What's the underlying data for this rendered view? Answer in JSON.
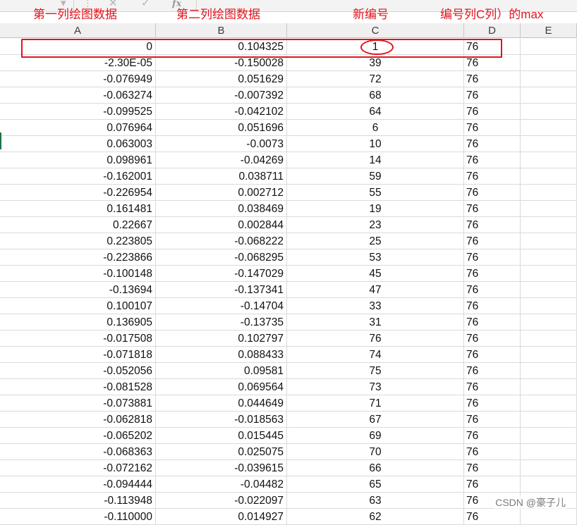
{
  "toolbar": {
    "dropdown_glyph": "▾",
    "more_glyph": "⋮",
    "cancel_glyph": "✕",
    "confirm_glyph": "✓",
    "fx_label": "fx"
  },
  "column_headers": [
    "A",
    "B",
    "C",
    "D",
    "E"
  ],
  "annotations": {
    "col_a": "第一列绘图数据",
    "col_b": "第二列绘图数据",
    "col_c": "新编号",
    "col_d": "编号列C列）的max"
  },
  "rows": [
    {
      "a": "0",
      "b": "0.104325",
      "c": "1",
      "d": "76"
    },
    {
      "a": "-2.30E-05",
      "b": "-0.150028",
      "c": "39",
      "d": "76"
    },
    {
      "a": "-0.076949",
      "b": "0.051629",
      "c": "72",
      "d": "76"
    },
    {
      "a": "-0.063274",
      "b": "-0.007392",
      "c": "68",
      "d": "76"
    },
    {
      "a": "-0.099525",
      "b": "-0.042102",
      "c": "64",
      "d": "76"
    },
    {
      "a": "0.076964",
      "b": "0.051696",
      "c": "6",
      "d": "76"
    },
    {
      "a": "0.063003",
      "b": "-0.0073",
      "c": "10",
      "d": "76"
    },
    {
      "a": "0.098961",
      "b": "-0.04269",
      "c": "14",
      "d": "76"
    },
    {
      "a": "-0.162001",
      "b": "0.038711",
      "c": "59",
      "d": "76"
    },
    {
      "a": "-0.226954",
      "b": "0.002712",
      "c": "55",
      "d": "76"
    },
    {
      "a": "0.161481",
      "b": "0.038469",
      "c": "19",
      "d": "76"
    },
    {
      "a": "0.22667",
      "b": "0.002844",
      "c": "23",
      "d": "76"
    },
    {
      "a": "0.223805",
      "b": "-0.068222",
      "c": "25",
      "d": "76"
    },
    {
      "a": "-0.223866",
      "b": "-0.068295",
      "c": "53",
      "d": "76"
    },
    {
      "a": "-0.100148",
      "b": "-0.147029",
      "c": "45",
      "d": "76"
    },
    {
      "a": "-0.13694",
      "b": "-0.137341",
      "c": "47",
      "d": "76"
    },
    {
      "a": "0.100107",
      "b": "-0.14704",
      "c": "33",
      "d": "76"
    },
    {
      "a": "0.136905",
      "b": "-0.13735",
      "c": "31",
      "d": "76"
    },
    {
      "a": "-0.017508",
      "b": "0.102797",
      "c": "76",
      "d": "76"
    },
    {
      "a": "-0.071818",
      "b": "0.088433",
      "c": "74",
      "d": "76"
    },
    {
      "a": "-0.052056",
      "b": "0.09581",
      "c": "75",
      "d": "76"
    },
    {
      "a": "-0.081528",
      "b": "0.069564",
      "c": "73",
      "d": "76"
    },
    {
      "a": "-0.073881",
      "b": "0.044649",
      "c": "71",
      "d": "76"
    },
    {
      "a": "-0.062818",
      "b": "-0.018563",
      "c": "67",
      "d": "76"
    },
    {
      "a": "-0.065202",
      "b": "0.015445",
      "c": "69",
      "d": "76"
    },
    {
      "a": "-0.068363",
      "b": "0.025075",
      "c": "70",
      "d": "76"
    },
    {
      "a": "-0.072162",
      "b": "-0.039615",
      "c": "66",
      "d": "76"
    },
    {
      "a": "-0.094444",
      "b": "-0.04482",
      "c": "65",
      "d": "76"
    },
    {
      "a": "-0.113948",
      "b": "-0.022097",
      "c": "63",
      "d": "76"
    },
    {
      "a": "-0.110000",
      "b": "0.014927",
      "c": "62",
      "d": "76"
    }
  ],
  "watermark": "CSDN @豪子儿",
  "colors": {
    "annotation_red": "#e0141e",
    "header_bg": "#f0f0f0",
    "grid_line": "#dadada"
  }
}
